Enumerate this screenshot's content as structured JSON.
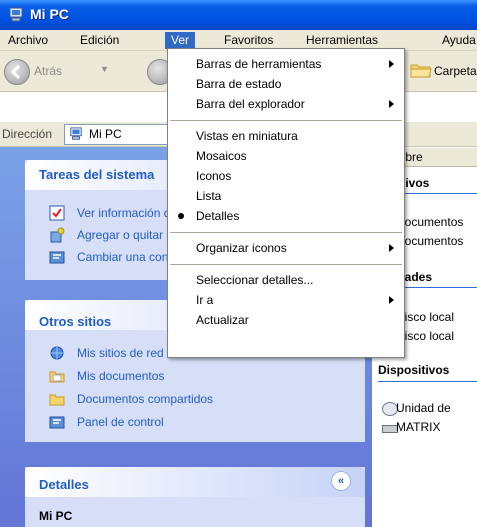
{
  "window": {
    "title": "Mi PC"
  },
  "menubar": {
    "items": [
      "Archivo",
      "Edición",
      "Ver",
      "Favoritos",
      "Herramientas",
      "Ayuda"
    ]
  },
  "toolbar": {
    "back_label": "Atrás",
    "folders_label": "Carpetas"
  },
  "addressbar": {
    "label": "Dirección",
    "value": "Mi PC"
  },
  "view_menu": {
    "items": [
      "Barras de herramientas",
      "Barra de estado",
      "Barra del explorador",
      "Vistas en miniatura",
      "Mosaicos",
      "Iconos",
      "Lista",
      "Detalles",
      "Organizar iconos",
      "Seleccionar detalles...",
      "Ir a",
      "Actualizar"
    ],
    "checked": "Detalles"
  },
  "left_panels": {
    "system_tasks": {
      "title": "Tareas del sistema",
      "items": [
        "Ver información del sistema",
        "Agregar o quitar programas",
        "Cambiar una configuración"
      ]
    },
    "other_places": {
      "title": "Otros sitios",
      "items": [
        "Mis sitios de red",
        "Mis documentos",
        "Documentos compartidos",
        "Panel de control"
      ]
    },
    "details": {
      "title": "Detalles",
      "item_name": "Mi PC"
    }
  },
  "right_pane": {
    "column_header": "Nombre",
    "groups": [
      {
        "title": "Archivos",
        "items": [
          "Documentos",
          "Documentos"
        ]
      },
      {
        "title": "Unidades",
        "items": [
          "Disco local",
          "Disco local"
        ]
      },
      {
        "title": "Dispositivos",
        "items": [
          "Unidad de",
          "MATRIX"
        ]
      }
    ]
  },
  "colors": {
    "xp_blue": "#0054e3",
    "menu_highlight": "#316ac5",
    "task_text": "#215dc6"
  }
}
